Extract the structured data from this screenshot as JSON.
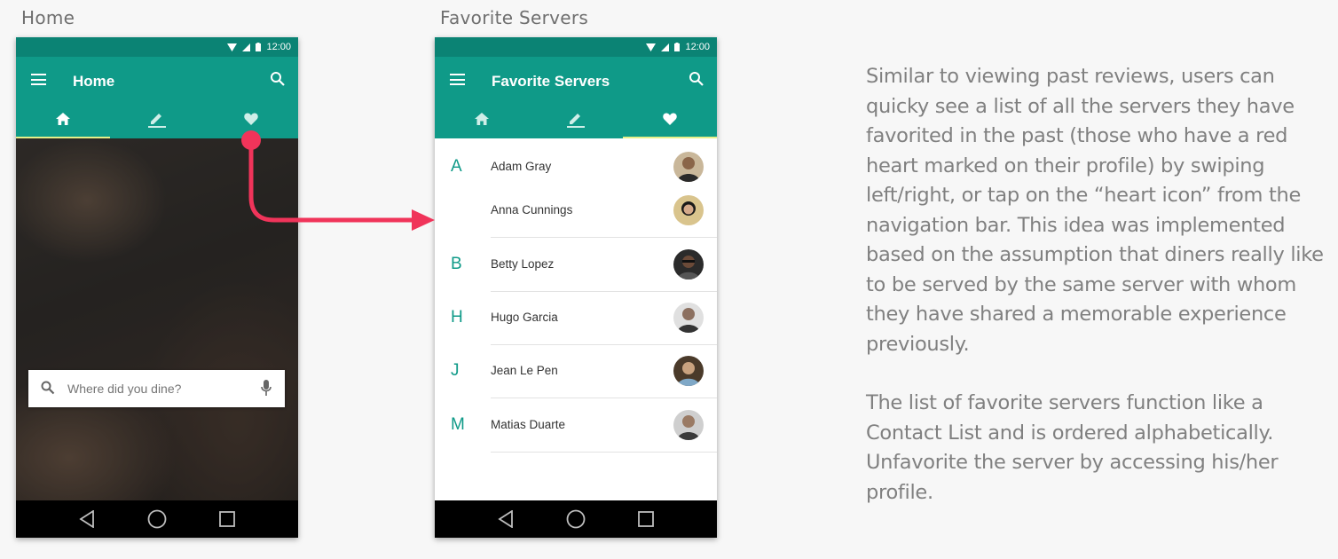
{
  "captions": {
    "left": "Home",
    "right": "Favorite Servers"
  },
  "status_bar": {
    "time": "12:00",
    "icons": [
      "wifi-icon",
      "signal-icon",
      "battery-icon"
    ]
  },
  "home_screen": {
    "title": "Home",
    "tabs": [
      {
        "icon": "home-icon",
        "selected": true
      },
      {
        "icon": "edit-icon",
        "selected": false
      },
      {
        "icon": "heart-icon",
        "selected": false
      }
    ],
    "search": {
      "placeholder": "Where did you dine?",
      "icons": [
        "search-icon",
        "mic-icon"
      ]
    }
  },
  "favorites_screen": {
    "title": "Favorite Servers",
    "tabs": [
      {
        "icon": "home-icon",
        "selected": false
      },
      {
        "icon": "edit-icon",
        "selected": false
      },
      {
        "icon": "heart-icon",
        "selected": true
      }
    ],
    "servers": [
      {
        "letter": "A",
        "name": "Adam Gray"
      },
      {
        "letter": "",
        "name": "Anna Cunnings"
      },
      {
        "letter": "B",
        "name": "Betty Lopez"
      },
      {
        "letter": "H",
        "name": "Hugo Garcia"
      },
      {
        "letter": "J",
        "name": "Jean Le Pen"
      },
      {
        "letter": "M",
        "name": "Matias Duarte"
      }
    ]
  },
  "nav_bar": {
    "icons": [
      "back-icon",
      "home-circle-icon",
      "recents-icon"
    ]
  },
  "description": {
    "paragraph1": "Similar to viewing past reviews, users can quicky see a list of all the servers they have favorited in the past (those who have a red heart marked on their profile) by swiping left/right, or tap on the “heart icon” from the navigation bar. This idea was implemented based on the assumption that diners really like to be served by the same server with whom they have shared a memorable experience previously.",
    "paragraph2": "The list of favorite servers function like a Contact List and is ordered alphabetically. Unfavorite the server by accessing his/her profile."
  },
  "colors": {
    "primary": "#0f9a88",
    "primary_dark": "#0b8374",
    "tab_indicator": "#e6f08a",
    "annotation_arrow": "#f0345a"
  }
}
